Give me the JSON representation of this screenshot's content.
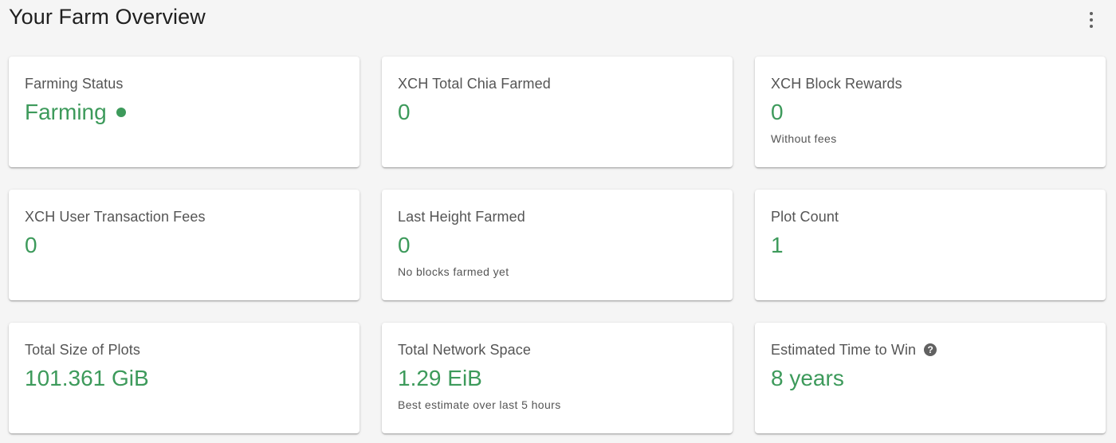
{
  "header": {
    "title": "Your Farm Overview",
    "menu_icon": "more-vert-icon"
  },
  "colors": {
    "accent": "#3d9a5b",
    "label": "#555555",
    "background": "#f5f5f5",
    "card": "#ffffff"
  },
  "cards": [
    {
      "label": "Farming Status",
      "value": "Farming",
      "status_icon": "status-dot-icon",
      "sub": ""
    },
    {
      "label": "XCH Total Chia Farmed",
      "value": "0",
      "sub": ""
    },
    {
      "label": "XCH Block Rewards",
      "value": "0",
      "sub": "Without fees"
    },
    {
      "label": "XCH User Transaction Fees",
      "value": "0",
      "sub": ""
    },
    {
      "label": "Last Height Farmed",
      "value": "0",
      "sub": "No blocks farmed yet"
    },
    {
      "label": "Plot Count",
      "value": "1",
      "sub": ""
    },
    {
      "label": "Total Size of Plots",
      "value": "101.361 GiB",
      "sub": ""
    },
    {
      "label": "Total Network Space",
      "value": "1.29 EiB",
      "sub": "Best estimate over last 5 hours"
    },
    {
      "label": "Estimated Time to Win",
      "value": "8 years",
      "label_icon": "help-icon",
      "help_glyph": "?",
      "sub": ""
    }
  ]
}
